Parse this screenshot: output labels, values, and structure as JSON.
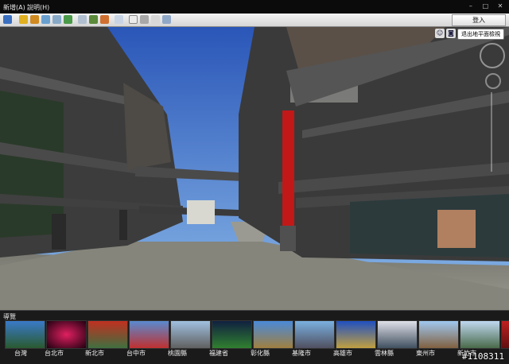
{
  "menu": {
    "items": [
      "新增(A)",
      "說明(H)"
    ]
  },
  "window": {
    "controls": [
      "–",
      "□",
      "✕"
    ]
  },
  "toolbar": {
    "login_label": "登入"
  },
  "view": {
    "exit_label": "退出地平面檢視"
  },
  "strip": {
    "title": "導覽",
    "items": [
      {
        "label": "台灣"
      },
      {
        "label": "台北市"
      },
      {
        "label": "新北市"
      },
      {
        "label": "台中市"
      },
      {
        "label": "桃園縣"
      },
      {
        "label": "福建省"
      },
      {
        "label": "彰化縣"
      },
      {
        "label": "基隆市"
      },
      {
        "label": "高雄市"
      },
      {
        "label": "雲林縣"
      },
      {
        "label": "東州市"
      },
      {
        "label": "新竹市"
      }
    ]
  },
  "watermark": "#1108311"
}
